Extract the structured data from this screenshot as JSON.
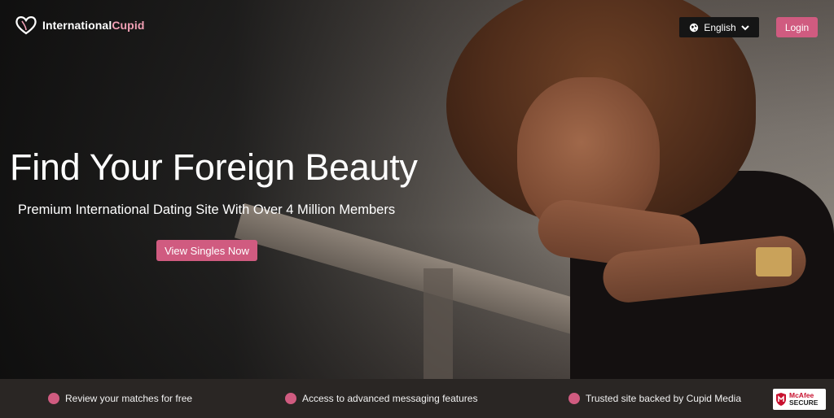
{
  "brand": {
    "name_main": "International",
    "name_accent": "Cupid",
    "icon": "heart-logo-icon"
  },
  "header": {
    "language_label": "English",
    "login_label": "Login"
  },
  "hero": {
    "headline": "Find Your Foreign Beauty",
    "subheadline": "Premium International Dating Site With Over 4 Million Members",
    "cta_label": "View Singles Now"
  },
  "features": [
    {
      "label": "Review your matches for free"
    },
    {
      "label": "Access to advanced messaging features"
    },
    {
      "label": "Trusted site backed by Cupid Media"
    }
  ],
  "badge": {
    "line1": "McAfee",
    "line2": "SECURE"
  },
  "colors": {
    "accent": "#d05b80",
    "dark_button": "#151515",
    "footer_bg": "#2a2624",
    "logo_accent": "#f2a0b5"
  }
}
